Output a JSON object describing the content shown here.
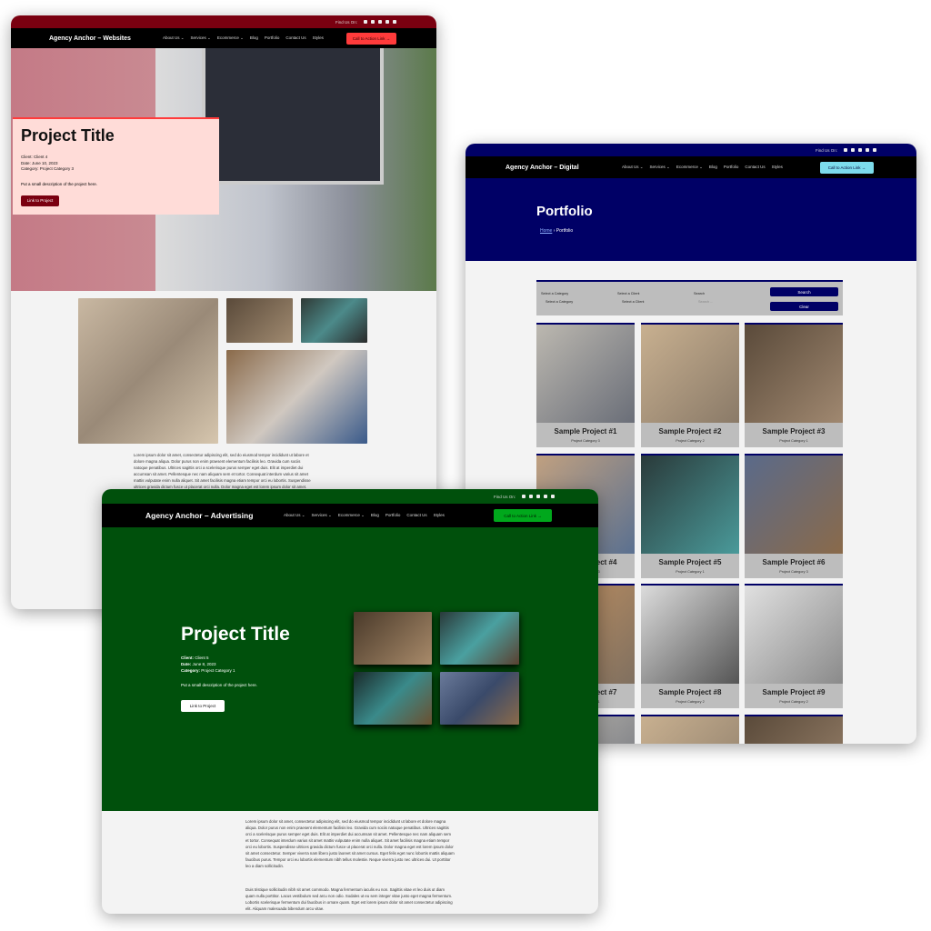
{
  "websites": {
    "find_us": "Find Us On:",
    "social_icons": [
      "facebook-icon",
      "twitter-icon",
      "linkedin-icon",
      "twitch-icon",
      "mastodon-icon"
    ],
    "brand": "Agency Anchor – Websites",
    "menu": [
      "About Us ⌄",
      "Services ⌄",
      "Ecommerce ⌄",
      "Blog",
      "Portfolio",
      "Contact Us",
      "Styles"
    ],
    "cta": "Call to Action Link →",
    "title": "Project Title",
    "client": "Client: Client 4",
    "date": "Date: June 10, 2023",
    "category": "Category: Project Category 3",
    "description": "Put a small description of the project here.",
    "link": "Link to Project",
    "body": "Lorem ipsum dolor sit amet, consectetur adipiscing elit, sed do eiusmod tempor incididunt ut labore et dolore magna aliqua. Dolor purus non enim praesent elementum facilisis leo. Gravida cum sociis natoque penatibus. Ultrices sagittis orci a scelerisque purus semper eget duis. Elit at imperdiet dui accumsan sit amet. Pellentesque nec nam aliquam sem et tortor. Consequat interdum varius sit amet mattis vulputate enim nulla aliquet. Sit amet facilisis magna etiam tempor orci eu lobortis. Suspendisse ultrices gravida dictum fusce ut placerat orci nulla. Dolor magna eget est lorem ipsum dolor sit amet.",
    "colors": {
      "topbar": "#7a0010",
      "cta": "#ff3b3b",
      "overlay": "#ffdcd8",
      "button": "#7a0010"
    }
  },
  "digital": {
    "find_us": "Find Us On:",
    "brand": "Agency Anchor – Digital",
    "menu": [
      "About Us ⌄",
      "Services ⌄",
      "Ecommerce ⌄",
      "Blog",
      "Portfolio",
      "Contact Us",
      "Styles"
    ],
    "cta": "Call to Action Link →",
    "title": "Portfolio",
    "breadcrumb": {
      "home": "Home",
      "sep": "›",
      "current": "Portfolio"
    },
    "filters": {
      "category_label": "Select a Category",
      "category_value": "Select a Category",
      "client_label": "Select a Client",
      "client_value": "Select a Client",
      "search_label": "Search",
      "search_placeholder": "Search ...",
      "search_button": "Search",
      "clear_button": "Clear"
    },
    "projects": [
      {
        "title": "Sample Project #1",
        "category": "Project Category 3"
      },
      {
        "title": "Sample Project #2",
        "category": "Project Category 2"
      },
      {
        "title": "Sample Project #3",
        "category": "Project Category 1"
      },
      {
        "title": "Sample Project #4",
        "category": "Project Category 3"
      },
      {
        "title": "Sample Project #5",
        "category": "Project Category 1"
      },
      {
        "title": "Sample Project #6",
        "category": "Project Category 3"
      },
      {
        "title": "Sample Project #7",
        "category": "Project Category 1"
      },
      {
        "title": "Sample Project #8",
        "category": "Project Category 2"
      },
      {
        "title": "Sample Project #9",
        "category": "Project Category 2"
      }
    ],
    "colors": {
      "primary": "#000066",
      "cta": "#7ddcec"
    }
  },
  "advertising": {
    "find_us": "Find Us On:",
    "brand": "Agency Anchor – Advertising",
    "menu": [
      "About Us ⌄",
      "Services ⌄",
      "Ecommerce ⌄",
      "Blog",
      "Portfolio",
      "Contact Us",
      "Styles"
    ],
    "cta": "Call to Action Link →",
    "title": "Project Title",
    "client_label": "Client:",
    "client": "Client 5",
    "date_label": "Date:",
    "date": "June 8, 2023",
    "category_label": "Category:",
    "category": "Project Category 1",
    "description": "Put a small description of the project here.",
    "link": "Link to Project",
    "body1": "Lorem ipsum dolor sit amet, consectetur adipiscing elit, sed do eiusmod tempor incididunt ut labore et dolore magna aliqua. Dolor purus non enim praesent elementum facilisis leo. Gravida cum sociis natoque penatibus. Ultrices sagittis orci a scelerisque purus semper eget duis. Elit at imperdiet dui accumsan sit amet. Pellentesque nec nam aliquam sem et tortor. Consequat interdum varius sit amet mattis vulputate enim nulla aliquet. Sit amet facilisis magna etiam tempor orci eu lobortis. Suspendisse ultrices gravida dictum fusce ut placerat orci nulla. Dolor magna eget est lorem ipsum dolor sit amet consectetur. Semper viverra nam libero justo laoreet sit amet cursus. Eget felis eget nunc lobortis mattis aliquam faucibus purus. Tempor orci eu lobortis elementum nibh tellus molestie. Neque viverra justo nec ultrices dui. Ut porttitor leo a diam sollicitudin.",
    "body2": "Duis tristique sollicitudin nibh sit amet commodo. Magna fermentum iaculis eu non. Sagittis vitae et leo duis ut diam quam nulla porttitor. Lacus vestibulum sed arcu non odio. Sodales ut eu sem integer vitae justo eget magna fermentum. Lobortis scelerisque fermentum dui faucibus in ornare quam. Eget est lorem ipsum dolor sit amet consectetur adipiscing elit. Aliquam malesuada bibendum arcu vitae.",
    "colors": {
      "primary": "#00500c",
      "cta": "#00a81c"
    }
  }
}
